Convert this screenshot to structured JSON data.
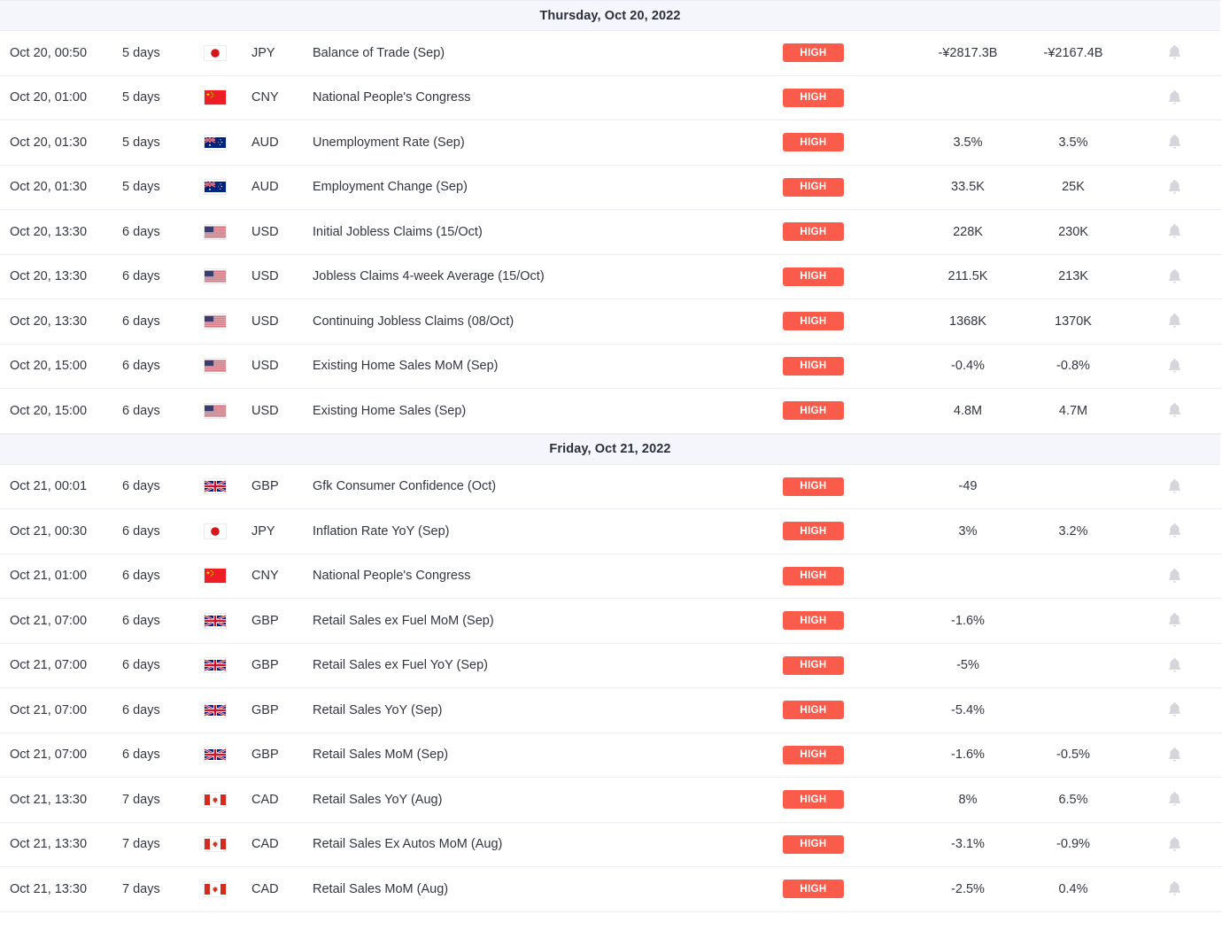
{
  "colors": {
    "impact_high_bg": "#fb5b4b",
    "impact_high_text": "#ffffff",
    "day_header_bg": "#f5f6fb",
    "row_border": "#eceef3",
    "text": "#32363f",
    "bell": "#d4d6dc"
  },
  "icons": {
    "bell": "bell-icon",
    "flag_jp": "flag-japan-icon",
    "flag_cn": "flag-china-icon",
    "flag_au": "flag-australia-icon",
    "flag_us": "flag-united-states-icon",
    "flag_gb": "flag-united-kingdom-icon",
    "flag_ca": "flag-canada-icon"
  },
  "days": [
    {
      "header": "Thursday, Oct 20, 2022",
      "rows": [
        {
          "date": "Oct 20, 00:50",
          "ago": "5 days",
          "flag": "jp",
          "currency": "JPY",
          "event": "Balance of Trade (Sep)",
          "impact": "HIGH",
          "actual": "-¥2817.3B",
          "forecast": "-¥2167.4B"
        },
        {
          "date": "Oct 20, 01:00",
          "ago": "5 days",
          "flag": "cn",
          "currency": "CNY",
          "event": "National People's Congress",
          "impact": "HIGH",
          "actual": "",
          "forecast": ""
        },
        {
          "date": "Oct 20, 01:30",
          "ago": "5 days",
          "flag": "au",
          "currency": "AUD",
          "event": "Unemployment Rate (Sep)",
          "impact": "HIGH",
          "actual": "3.5%",
          "forecast": "3.5%"
        },
        {
          "date": "Oct 20, 01:30",
          "ago": "5 days",
          "flag": "au",
          "currency": "AUD",
          "event": "Employment Change (Sep)",
          "impact": "HIGH",
          "actual": "33.5K",
          "forecast": "25K"
        },
        {
          "date": "Oct 20, 13:30",
          "ago": "6 days",
          "flag": "us",
          "currency": "USD",
          "event": "Initial Jobless Claims (15/Oct)",
          "impact": "HIGH",
          "actual": "228K",
          "forecast": "230K"
        },
        {
          "date": "Oct 20, 13:30",
          "ago": "6 days",
          "flag": "us",
          "currency": "USD",
          "event": "Jobless Claims 4-week Average (15/Oct)",
          "impact": "HIGH",
          "actual": "211.5K",
          "forecast": "213K"
        },
        {
          "date": "Oct 20, 13:30",
          "ago": "6 days",
          "flag": "us",
          "currency": "USD",
          "event": "Continuing Jobless Claims (08/Oct)",
          "impact": "HIGH",
          "actual": "1368K",
          "forecast": "1370K"
        },
        {
          "date": "Oct 20, 15:00",
          "ago": "6 days",
          "flag": "us",
          "currency": "USD",
          "event": "Existing Home Sales MoM (Sep)",
          "impact": "HIGH",
          "actual": "-0.4%",
          "forecast": "-0.8%"
        },
        {
          "date": "Oct 20, 15:00",
          "ago": "6 days",
          "flag": "us",
          "currency": "USD",
          "event": "Existing Home Sales (Sep)",
          "impact": "HIGH",
          "actual": "4.8M",
          "forecast": "4.7M"
        }
      ]
    },
    {
      "header": "Friday, Oct 21, 2022",
      "rows": [
        {
          "date": "Oct 21, 00:01",
          "ago": "6 days",
          "flag": "gb",
          "currency": "GBP",
          "event": "Gfk Consumer Confidence (Oct)",
          "impact": "HIGH",
          "actual": "-49",
          "forecast": ""
        },
        {
          "date": "Oct 21, 00:30",
          "ago": "6 days",
          "flag": "jp",
          "currency": "JPY",
          "event": "Inflation Rate YoY (Sep)",
          "impact": "HIGH",
          "actual": "3%",
          "forecast": "3.2%"
        },
        {
          "date": "Oct 21, 01:00",
          "ago": "6 days",
          "flag": "cn",
          "currency": "CNY",
          "event": "National People's Congress",
          "impact": "HIGH",
          "actual": "",
          "forecast": ""
        },
        {
          "date": "Oct 21, 07:00",
          "ago": "6 days",
          "flag": "gb",
          "currency": "GBP",
          "event": "Retail Sales ex Fuel MoM (Sep)",
          "impact": "HIGH",
          "actual": "-1.6%",
          "forecast": ""
        },
        {
          "date": "Oct 21, 07:00",
          "ago": "6 days",
          "flag": "gb",
          "currency": "GBP",
          "event": "Retail Sales ex Fuel YoY (Sep)",
          "impact": "HIGH",
          "actual": "-5%",
          "forecast": ""
        },
        {
          "date": "Oct 21, 07:00",
          "ago": "6 days",
          "flag": "gb",
          "currency": "GBP",
          "event": "Retail Sales YoY (Sep)",
          "impact": "HIGH",
          "actual": "-5.4%",
          "forecast": ""
        },
        {
          "date": "Oct 21, 07:00",
          "ago": "6 days",
          "flag": "gb",
          "currency": "GBP",
          "event": "Retail Sales MoM (Sep)",
          "impact": "HIGH",
          "actual": "-1.6%",
          "forecast": "-0.5%"
        },
        {
          "date": "Oct 21, 13:30",
          "ago": "7 days",
          "flag": "ca",
          "currency": "CAD",
          "event": "Retail Sales YoY (Aug)",
          "impact": "HIGH",
          "actual": "8%",
          "forecast": "6.5%"
        },
        {
          "date": "Oct 21, 13:30",
          "ago": "7 days",
          "flag": "ca",
          "currency": "CAD",
          "event": "Retail Sales Ex Autos MoM (Aug)",
          "impact": "HIGH",
          "actual": "-3.1%",
          "forecast": "-0.9%"
        },
        {
          "date": "Oct 21, 13:30",
          "ago": "7 days",
          "flag": "ca",
          "currency": "CAD",
          "event": "Retail Sales MoM (Aug)",
          "impact": "HIGH",
          "actual": "-2.5%",
          "forecast": "0.4%"
        }
      ]
    }
  ]
}
